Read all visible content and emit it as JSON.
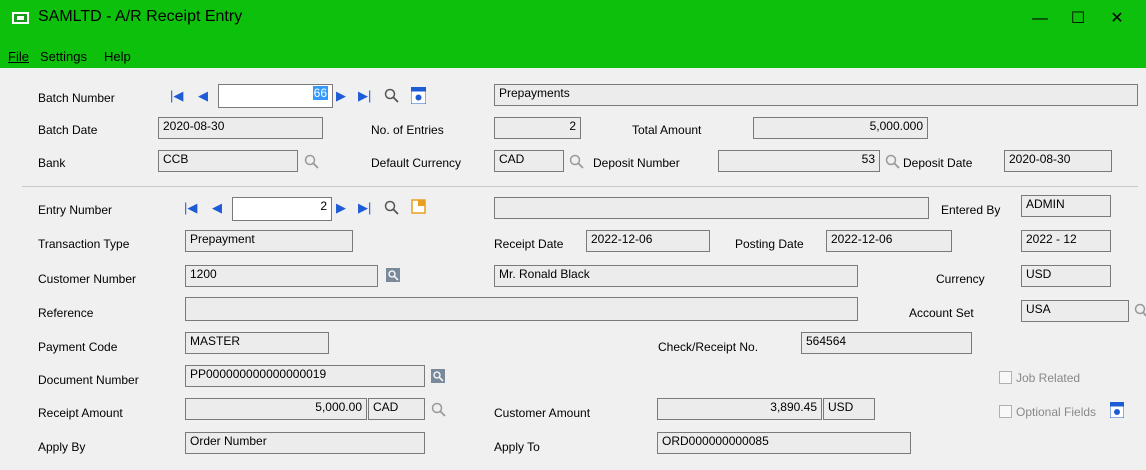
{
  "window": {
    "title": "SAMLTD - A/R Receipt Entry",
    "minimize": "—",
    "maximize": "☐",
    "close": "✕"
  },
  "menu": [
    "File",
    "Settings",
    "Help"
  ],
  "batch": {
    "number_label": "Batch Number",
    "number_value": "66",
    "description": "Prepayments",
    "date_label": "Batch Date",
    "date_value": "2020-08-30",
    "entries_label": "No. of Entries",
    "entries_value": "2",
    "total_label": "Total Amount",
    "total_value": "5,000.000",
    "bank_label": "Bank",
    "bank_value": "CCB",
    "default_currency_label": "Default Currency",
    "default_currency_value": "CAD",
    "deposit_number_label": "Deposit Number",
    "deposit_number_value": "53",
    "deposit_date_label": "Deposit Date",
    "deposit_date_value": "2020-08-30"
  },
  "entry": {
    "number_label": "Entry Number",
    "number_value": "2",
    "description": "",
    "entered_by_label": "Entered By",
    "entered_by_value": "ADMIN",
    "transaction_type_label": "Transaction Type",
    "transaction_type_value": "Prepayment",
    "receipt_date_label": "Receipt Date",
    "receipt_date_value": "2022-12-06",
    "posting_date_label": "Posting Date",
    "posting_date_value": "2022-12-06",
    "period_value": "2022 - 12",
    "customer_number_label": "Customer Number",
    "customer_number_value": "1200",
    "customer_name_value": "Mr. Ronald Black",
    "currency_label": "Currency",
    "currency_value": "USD",
    "reference_label": "Reference",
    "reference_value": "",
    "account_set_label": "Account Set",
    "account_set_value": "USA",
    "payment_code_label": "Payment Code",
    "payment_code_value": "MASTER",
    "check_receipt_label": "Check/Receipt No.",
    "check_receipt_value": "564564",
    "document_number_label": "Document Number",
    "document_number_value": "PP000000000000000019",
    "job_related_label": "Job Related",
    "receipt_amount_label": "Receipt Amount",
    "receipt_amount_value": "5,000.00",
    "receipt_currency_value": "CAD",
    "customer_amount_label": "Customer Amount",
    "customer_amount_value": "3,890.45",
    "customer_amount_currency": "USD",
    "optional_fields_label": "Optional Fields",
    "apply_by_label": "Apply By",
    "apply_by_value": "Order Number",
    "apply_to_label": "Apply To",
    "apply_to_value": "ORD000000000085"
  },
  "colors": {
    "titlebar": "#0cc00c",
    "nav_blue": "#1e5cd6"
  }
}
